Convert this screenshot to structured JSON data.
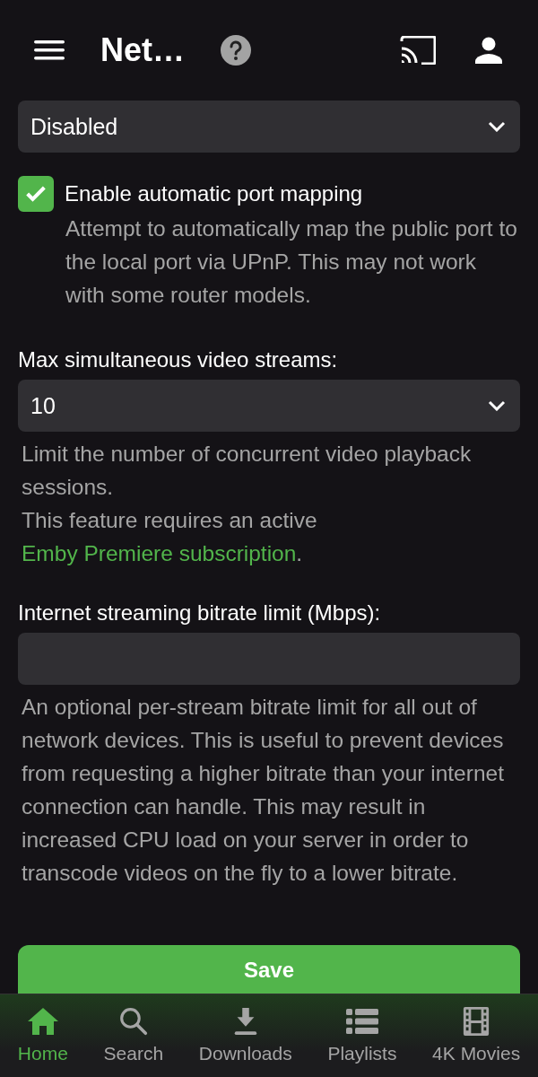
{
  "header": {
    "title": "Net…"
  },
  "fields": [
    {
      "kind": "select",
      "value": "Disabled"
    },
    {
      "kind": "checkbox",
      "label": "Enable automatic port mapping",
      "checked": true,
      "description": "Attempt to automatically map the public port to the local port via UPnP. This may not work with some router models."
    },
    {
      "kind": "select",
      "label": "Max simultaneous video streams:",
      "value": "10",
      "description": "Limit the number of concurrent video playback sessions.",
      "note": "This feature requires an active",
      "link": "Emby Premiere subscription",
      "note_end": "."
    },
    {
      "kind": "text",
      "label": "Internet streaming bitrate limit (Mbps):",
      "description": "An optional per-stream bitrate limit for all out of network devices. This is useful to prevent devices from requesting a higher bitrate than your internet connection can handle. This may result in increased CPU load on your server in order to transcode videos on the fly to a lower bitrate."
    }
  ],
  "save_button": "Save",
  "nav": [
    {
      "label": "Home",
      "selected": true
    },
    {
      "label": "Search",
      "selected": false
    },
    {
      "label": "Downloads",
      "selected": false
    },
    {
      "label": "Playlists",
      "selected": false
    },
    {
      "label": "4K Movies",
      "selected": false
    }
  ]
}
